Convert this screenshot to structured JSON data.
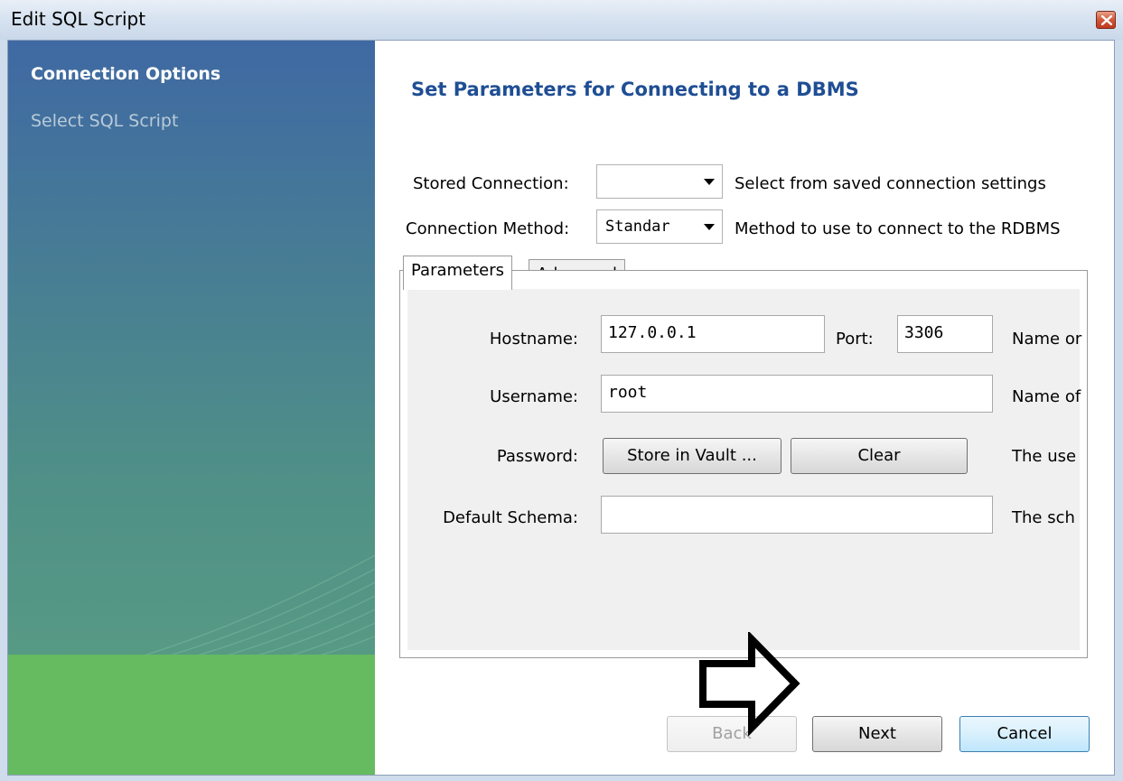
{
  "window": {
    "title": "Edit SQL Script"
  },
  "sidebar": {
    "items": [
      {
        "label": "Connection Options",
        "active": true
      },
      {
        "label": "Select SQL Script",
        "active": false
      }
    ]
  },
  "main": {
    "heading": "Set Parameters for Connecting to a DBMS",
    "stored_connection": {
      "label": "Stored Connection:",
      "value": "",
      "help": "Select from saved connection settings"
    },
    "connection_method": {
      "label": "Connection Method:",
      "value": "Standar",
      "help": "Method to use to connect to the RDBMS"
    },
    "tabs": [
      {
        "label": "Parameters",
        "active": true
      },
      {
        "label": "Advanced",
        "active": false
      }
    ],
    "parameters": {
      "hostname": {
        "label": "Hostname:",
        "value": "127.0.0.1",
        "help": "Name or"
      },
      "port": {
        "label": "Port:",
        "value": "3306"
      },
      "username": {
        "label": "Username:",
        "value": "root",
        "help": "Name of"
      },
      "password": {
        "label": "Password:",
        "store_button": "Store in Vault ...",
        "clear_button": "Clear",
        "help": "The use"
      },
      "default_schema": {
        "label": "Default Schema:",
        "value": "",
        "help": "The sch"
      }
    }
  },
  "footer": {
    "back_label": "Back",
    "next_label": "Next",
    "cancel_label": "Cancel"
  },
  "colors": {
    "heading": "#1f4e94",
    "sidebar_top": "#3f69a3",
    "sidebar_green": "#66bb60"
  }
}
